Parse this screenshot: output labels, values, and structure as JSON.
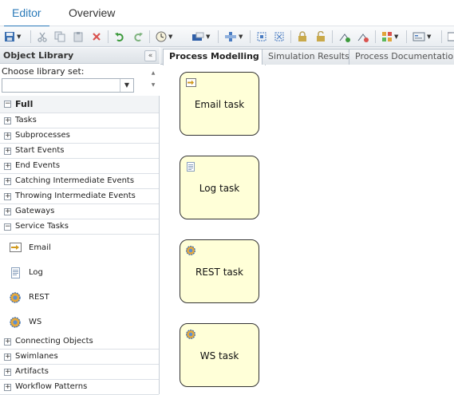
{
  "top_tabs": {
    "editor": "Editor",
    "overview": "Overview"
  },
  "library": {
    "title": "Object Library",
    "collapse_glyph": "«",
    "choose_label": "Choose library set:",
    "select_value": "",
    "tree": {
      "full_label": "Full",
      "groups_before": [
        "Tasks",
        "Subprocesses",
        "Start Events",
        "End Events",
        "Catching Intermediate Events",
        "Throwing Intermediate Events",
        "Gateways"
      ],
      "service_tasks_label": "Service Tasks",
      "service_items": [
        {
          "label": "Email",
          "icon": "email-task-icon"
        },
        {
          "label": "Log",
          "icon": "log-task-icon"
        },
        {
          "label": "REST",
          "icon": "gear-icon"
        },
        {
          "label": "WS",
          "icon": "gear-icon"
        }
      ],
      "groups_after": [
        "Connecting Objects",
        "Swimlanes",
        "Artifacts",
        "Workflow Patterns"
      ]
    }
  },
  "canvas_tabs": [
    "Process Modelling",
    "Simulation Results",
    "Process Documentation"
  ],
  "canvas": {
    "tasks": [
      {
        "label": "Email task",
        "icon": "email-task-icon"
      },
      {
        "label": "Log task",
        "icon": "log-task-icon"
      },
      {
        "label": "REST task",
        "icon": "gear-icon"
      },
      {
        "label": "WS task",
        "icon": "gear-icon"
      }
    ]
  },
  "colors": {
    "accent": "#2a7ab9",
    "task_fill": "#ffffd8",
    "task_border": "#333333"
  }
}
